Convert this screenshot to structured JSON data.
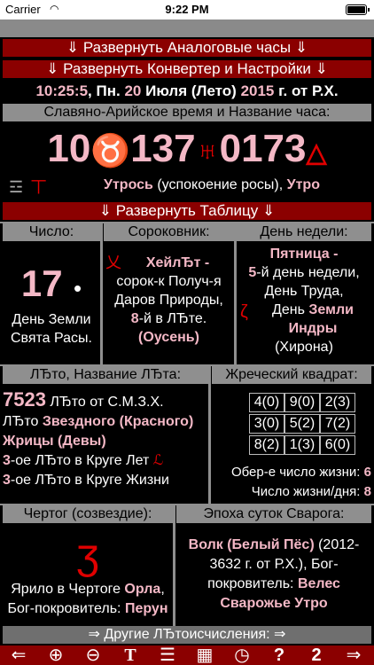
{
  "status": {
    "carrier": "Carrier",
    "time": "9:22 PM"
  },
  "bars": {
    "analog": "⇓ Развернуть Аналоговые часы ⇓",
    "converter": "⇓ Развернуть Конвертер и Настройки ⇓",
    "table": "⇓ Развернуть Таблицу ⇓",
    "other": "⇒ Другие ЛЂтоисчисления: ⇒"
  },
  "date": {
    "time": "10:25:5",
    "weekday": "Пн.",
    "day": "20",
    "month": "Июля (Лето)",
    "year": "2015",
    "era": "г. от Р.Х."
  },
  "slavic_time": {
    "heading": "Славяно-Арийское время и Название часа:",
    "h": "10",
    "m": "137",
    "s": "0173",
    "desc1": "Утрось",
    "desc2": "(успокоение росы),",
    "desc3": "Утро"
  },
  "headers": {
    "number": "Число:",
    "sorok": "Сороковник:",
    "weekday": "День недели:",
    "leto": "ЛЂто, Название ЛЂта:",
    "square": "Жреческий квадрат:",
    "chertog": "Чертог (созвездие):",
    "epoch": "Эпоха суток Сварога:"
  },
  "number": {
    "value": "17",
    "dot": "•",
    "line1": "День Земли",
    "line2": "Свята Расы."
  },
  "sorok": {
    "name": "ХейлЂт -",
    "line1": "сорок-к Получ-я",
    "line2": "Даров Природы,",
    "num": "8",
    "line3": "-й в ЛЂте.",
    "season": "(Оусень)"
  },
  "weekday": {
    "name": "Пятница -",
    "num": "5",
    "line1": "-й день недели,",
    "line2": "День Труда,",
    "line3": "День",
    "earth": "Земли Индры",
    "line4": "(Хирона)"
  },
  "leto": {
    "num": "7523",
    "num_tail": "ЛЂто от С.М.З.Х.",
    "prefix": "ЛЂто",
    "name": "Звездного (Красного) Жрицы (Девы)",
    "c1": "3",
    "line1": "-ое ЛЂто в Круге Лет",
    "c2": "3",
    "line2": "-ое ЛЂто в Круге Жизни"
  },
  "square": {
    "cells": [
      "4(0)",
      "9(0)",
      "2(3)",
      "3(0)",
      "5(2)",
      "7(2)",
      "8(2)",
      "1(3)",
      "6(0)"
    ],
    "ober_label": "Обер-е число жизни:",
    "ober": "6",
    "life_label": "Число жизни/дня:",
    "life": "8"
  },
  "chertog": {
    "line1": "Ярило в Чертоге",
    "name": "Орла",
    "line2": "Бог-покровитель:",
    "god": "Перун"
  },
  "epoch": {
    "name": "Волк (Белый Пёс)",
    "years": "(2012-3632 г. от Р.Х.),",
    "prefix": "Бог-покровитель:",
    "god": "Велес",
    "morning": "Сварожье Утро"
  },
  "nav": [
    "⇐",
    "⊕",
    "⊖",
    "T",
    "☰",
    "▦",
    "◷",
    "?",
    "2",
    "⇒"
  ],
  "colors": {
    "red": "#8b0000",
    "pink": "#f4b8c6",
    "rune": "#e00000"
  }
}
